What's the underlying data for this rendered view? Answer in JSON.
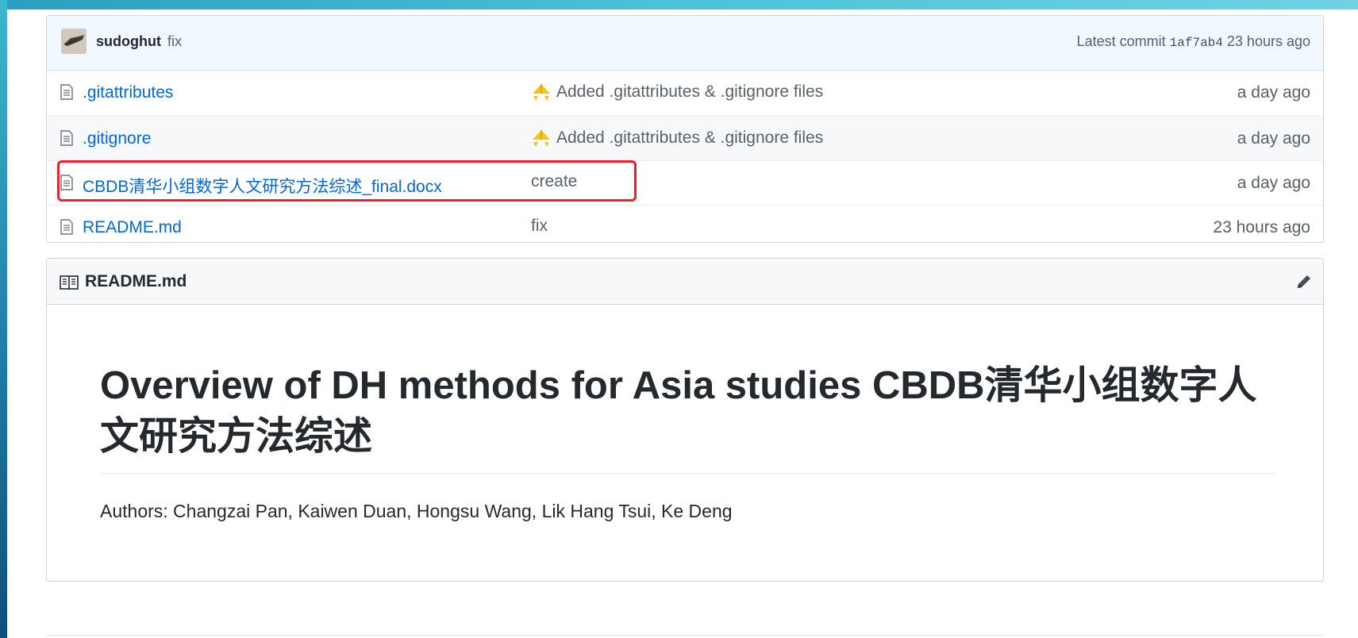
{
  "commit_bar": {
    "author": "sudoghut",
    "message": "fix",
    "latest_label": "Latest commit",
    "sha": "1af7ab4",
    "time": "23 hours ago"
  },
  "files": [
    {
      "name": ".gitattributes",
      "commit": "Added .gitattributes & .gitignore files",
      "commit_emoji": "tada-icon",
      "age": "a day ago"
    },
    {
      "name": ".gitignore",
      "commit": "Added .gitattributes & .gitignore files",
      "commit_emoji": "tada-icon",
      "age": "a day ago"
    },
    {
      "name": "CBDB清华小组数字人文研究方法综述_final.docx",
      "commit": "create",
      "age": "a day ago",
      "highlighted": true
    },
    {
      "name": "README.md",
      "commit": "fix",
      "age": "23 hours ago"
    }
  ],
  "readme": {
    "header": "README.md",
    "title": "Overview of DH methods for Asia studies CBDB清华小组数字人文研究方法综述",
    "authors": "Authors: Changzai Pan, Kaiwen Duan, Hongsu Wang, Lik Hang Tsui, Ke Deng"
  },
  "colors": {
    "link": "#0366d6",
    "muted": "#586069",
    "commit_bar_bg": "#f1f8ff",
    "highlight": "#e8202a",
    "frame": "#2a9fbf"
  }
}
